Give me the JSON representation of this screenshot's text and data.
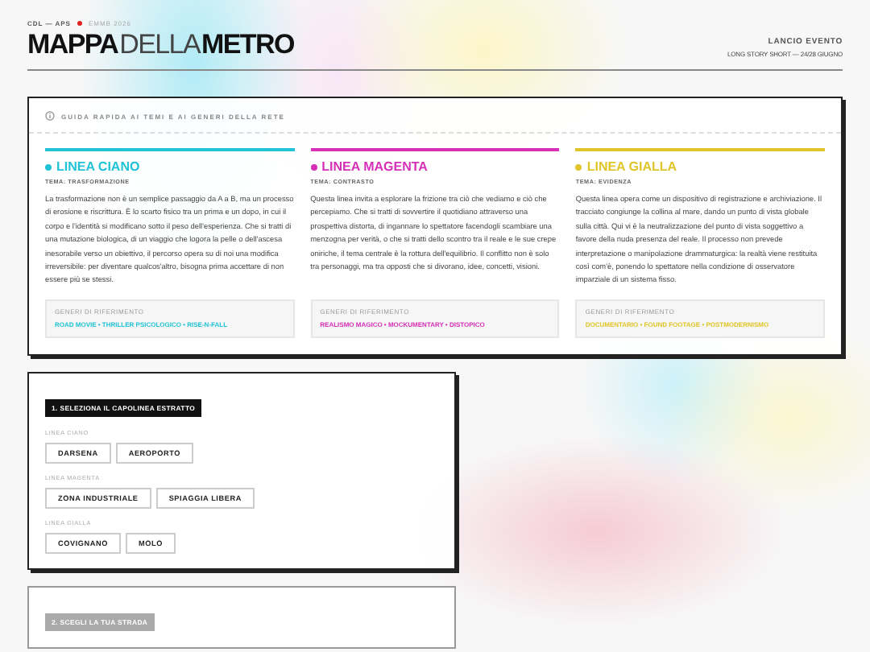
{
  "header": {
    "org": "CDL — APS",
    "edition": "EMMB 2026",
    "title_bold_1": "MAPPA",
    "title_light": "DELLA",
    "title_bold_2": "METRO",
    "event_label": "LANCIO EVENTO",
    "event_detail": "LONG STORY SHORT — 24/28 GIUGNO"
  },
  "guide": {
    "title": "GUIDA RAPIDA AI TEMI E AI GENERI DELLA RETE",
    "lines": [
      {
        "name": "LINEA CIANO",
        "color": "#22c3d6",
        "theme": "TEMA: TRASFORMAZIONE",
        "text": "La trasformazione non è un semplice passaggio da A a B, ma un processo di erosione e riscrittura. È lo scarto fisico tra un prima e un dopo, in cui il corpo e l'identità si modificano sotto il peso dell'esperienza. Che si tratti di una mutazione biologica, di un viaggio che logora la pelle o dell'ascesa inesorabile verso un obiettivo, il percorso opera su di noi una modifica irreversibile: per diventare qualcos'altro, bisogna prima accettare di non essere più se stessi.",
        "genres_label": "GENERI DI RIFERIMENTO",
        "genres": "ROAD MOVIE • THRILLER PSICOLOGICO • RISE-N-FALL"
      },
      {
        "name": "LINEA MAGENTA",
        "color": "#d62fb8",
        "theme": "TEMA: CONTRASTO",
        "text": "Questa linea invita a esplorare la frizione tra ciò che vediamo e ciò che percepiamo. Che si tratti di sovvertire il quotidiano attraverso una prospettiva distorta, di ingannare lo spettatore facendogli scambiare una menzogna per verità, o che si tratti dello scontro tra il reale e le sue crepe oniriche, il tema centrale è la rottura dell'equilibrio. Il conflitto non è solo tra personaggi, ma tra opposti che si divorano, idee, concetti, visioni.",
        "genres_label": "GENERI DI RIFERIMENTO",
        "genres": "REALISMO MAGICO • MOCKUMENTARY • DISTOPICO"
      },
      {
        "name": "LINEA GIALLA",
        "color": "#e0c52a",
        "theme": "TEMA: EVIDENZA",
        "text": "Questa linea opera come un dispositivo di registrazione e archiviazione. Il tracciato congiunge la collina al mare, dando un punto di vista globale sulla città. Qui vi è la neutralizzazione del punto di vista soggettivo a favore della nuda presenza del reale. Il processo non prevede interpretazione o manipolazione drammaturgica: la realtà viene restituita così com'è, ponendo lo spettatore nella condizione di osservatore imparziale di un sistema fisso.",
        "genres_label": "GENERI DI RIFERIMENTO",
        "genres": "DOCUMENTARIO • FOUND FOOTAGE • POSTMODERNISMO"
      }
    ]
  },
  "steps": [
    {
      "title": "1. SELEZIONA IL CAPOLINEA ESTRATTO",
      "active": true,
      "groups": [
        {
          "label": "LINEA CIANO",
          "options": [
            {
              "label": "DARSENA",
              "selected": false
            },
            {
              "label": "AEROPORTO",
              "selected": false
            }
          ]
        },
        {
          "label": "LINEA MAGENTA",
          "options": [
            {
              "label": "ZONA INDUSTRIALE",
              "selected": false
            },
            {
              "label": "SPIAGGIA LIBERA",
              "selected": false
            }
          ]
        },
        {
          "label": "LINEA GIALLA",
          "options": [
            {
              "label": "COVIGNANO",
              "selected": false
            },
            {
              "label": "MOLO",
              "selected": false
            }
          ]
        }
      ]
    },
    {
      "title": "2. SCEGLI LA TUA STRADA",
      "active": false
    }
  ]
}
